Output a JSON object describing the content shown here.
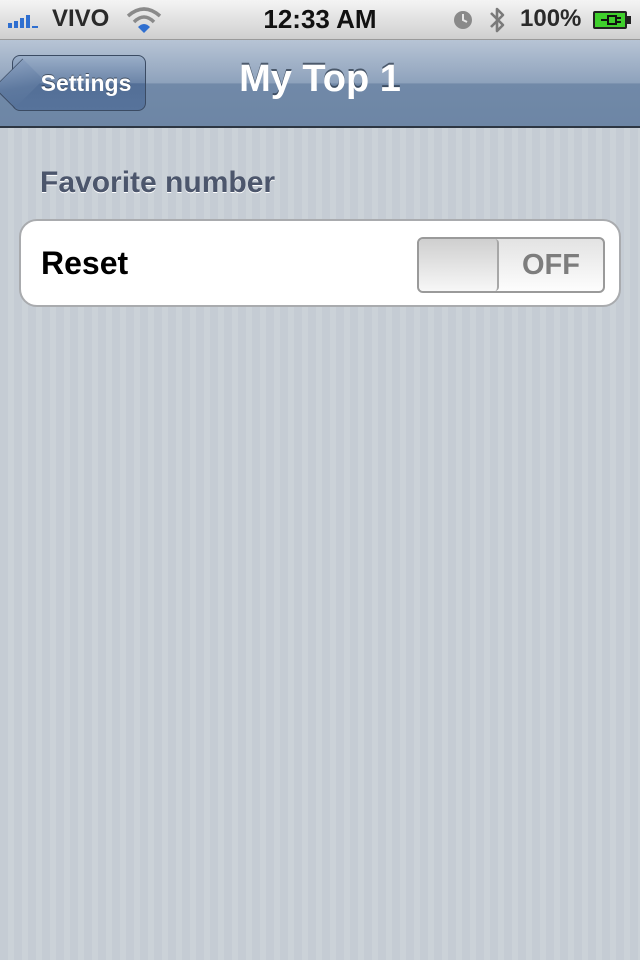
{
  "status_bar": {
    "carrier": "VIVO",
    "time": "12:33 AM",
    "battery_percent": "100%",
    "icons": [
      "signal-icon",
      "wifi-icon",
      "alarm-icon",
      "bluetooth-icon",
      "battery-charging-icon"
    ],
    "signal_color": "#2f6fd0",
    "battery_color": "#3fcf2c"
  },
  "nav_bar": {
    "back_label": "Settings",
    "title": "My Top 1",
    "color": "#6d86a5"
  },
  "section": {
    "header": "Favorite number",
    "rows": [
      {
        "label": "Reset",
        "switch_state": "OFF"
      }
    ]
  }
}
